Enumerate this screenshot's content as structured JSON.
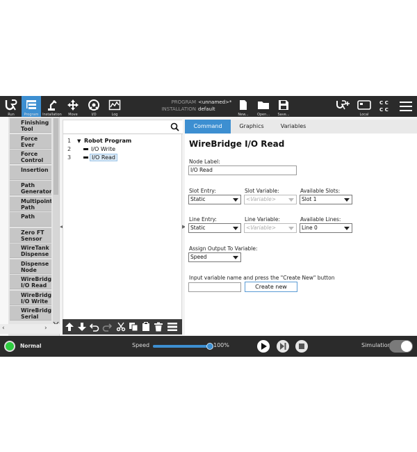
{
  "topbar": {
    "nav": [
      {
        "label": "Run",
        "icon": "ur-logo-icon"
      },
      {
        "label": "Program",
        "icon": "program-tree-icon"
      },
      {
        "label": "Installation",
        "icon": "robot-arm-icon"
      },
      {
        "label": "Move",
        "icon": "move-arrows-icon"
      },
      {
        "label": "I/O",
        "icon": "io-icon"
      },
      {
        "label": "Log",
        "icon": "log-chart-icon"
      }
    ],
    "program_key": "PROGRAM",
    "program_value": "<unnamed>*",
    "installation_key": "INSTALLATION",
    "installation_value": "default",
    "file_buttons": [
      {
        "label": "New...",
        "icon": "new-file-icon"
      },
      {
        "label": "Open...",
        "icon": "open-folder-icon"
      },
      {
        "label": "Save...",
        "icon": "save-icon"
      }
    ],
    "local_label": "Local",
    "cc_text": "C C\nC C"
  },
  "palette": {
    "items": [
      {
        "label": "Finishing Tool Contr"
      },
      {
        "label": "Force Ever"
      },
      {
        "label": "Force Control"
      },
      {
        "label": "Insertion"
      },
      {
        "label": "Path Generator"
      },
      {
        "label": "Multipoint Path"
      },
      {
        "label": "Path"
      },
      {
        "label": "Zero FT Sensor"
      },
      {
        "label": "WireTank Dispense"
      },
      {
        "label": "Dispense Node"
      },
      {
        "label": "WireBridge I/O Read"
      },
      {
        "label": "WireBridge I/O Write"
      },
      {
        "label": "WireBridge Serial"
      }
    ]
  },
  "tree": {
    "rows": [
      {
        "num": "1",
        "label": "Robot Program"
      },
      {
        "num": "2",
        "label": "I/O Write"
      },
      {
        "num": "3",
        "label": "I/O Read"
      }
    ]
  },
  "tabs": [
    "Command",
    "Graphics",
    "Variables"
  ],
  "command": {
    "title": "WireBridge I/O Read",
    "node_label_caption": "Node Label:",
    "node_label_value": "I/O Read",
    "slot_entry_caption": "Slot Entry:",
    "slot_entry_value": "Static",
    "slot_variable_caption": "Slot Variable:",
    "slot_variable_value": "<Variable>",
    "available_slots_caption": "Available Slots:",
    "available_slots_value": "Slot 1",
    "line_entry_caption": "Line Entry:",
    "line_entry_value": "Static",
    "line_variable_caption": "Line Variable:",
    "line_variable_value": "<Variable>",
    "available_lines_caption": "Available Lines:",
    "available_lines_value": "Line 0",
    "assign_caption": "Assign Output To Variable:",
    "assign_value": "Speed",
    "create_hint": "Input variable name and press the \"Create New\" button",
    "create_input_value": "",
    "create_button": "Create new"
  },
  "bottombar": {
    "status": "Normal",
    "speed_label": "Speed",
    "speed_value": "100%",
    "speed_fraction": 1.0,
    "simulation_label": "Simulation"
  },
  "colors": {
    "accent": "#3d8fd1",
    "topbar": "#2b2b2b",
    "status_green": "#2ecc40"
  }
}
